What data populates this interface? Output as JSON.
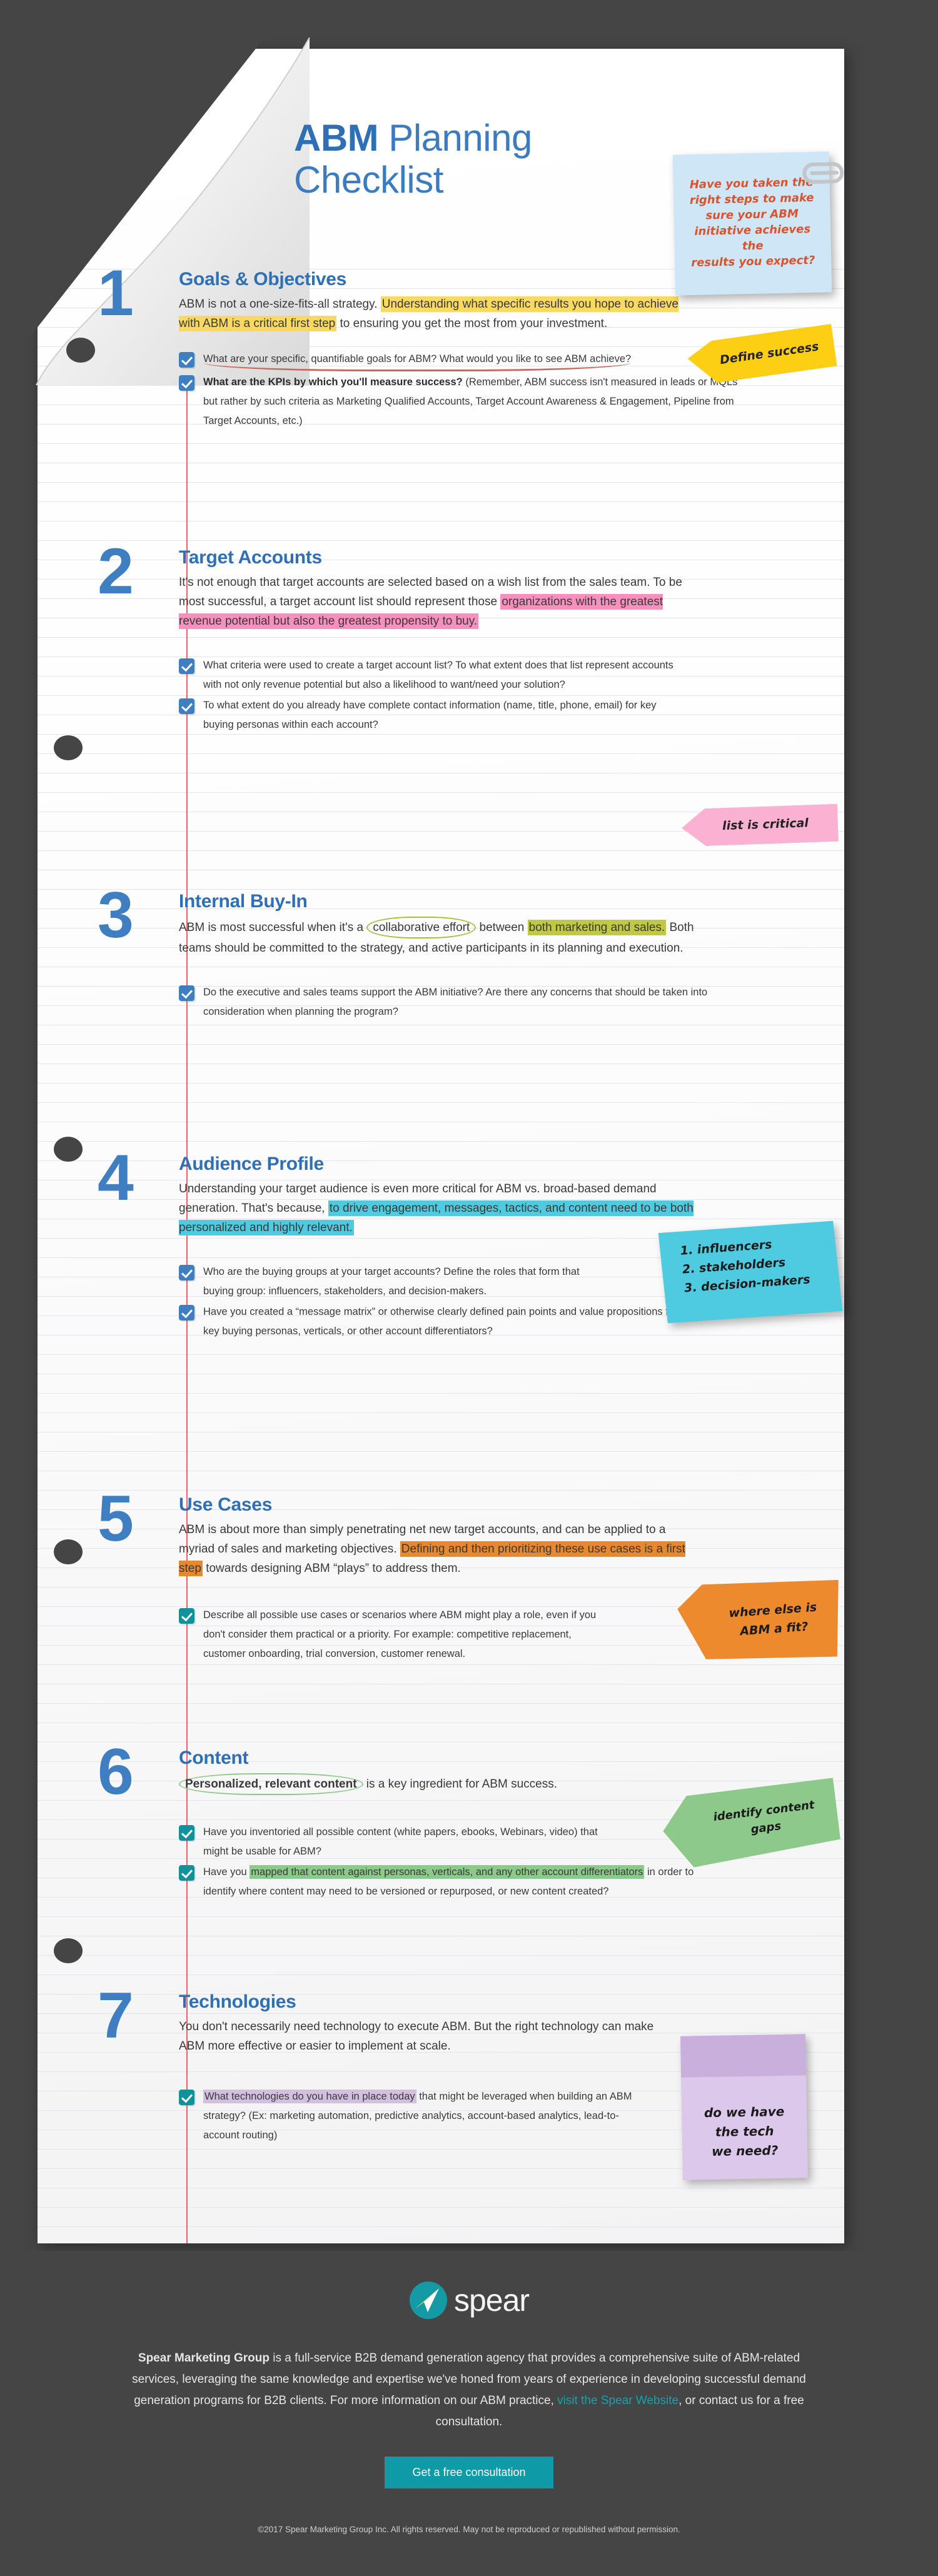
{
  "header": {
    "title_strong": "ABM",
    "title_rest": " Planning\nChecklist"
  },
  "colors": {
    "background": "#454545",
    "brand_blue": "#3f7fc1",
    "heading_blue": "#2f6fb5",
    "teal": "#0e9aa7",
    "margin_red": "#e8646b",
    "hl_yellow": "#f9d95f",
    "hl_pink": "#f88fbc",
    "hl_olive": "#c0c944",
    "hl_cyan": "#4ecbe0",
    "hl_orange": "#e8882c",
    "hl_green": "#8dc98a",
    "hl_purple": "#d3bfe0"
  },
  "sections": [
    {
      "number": "1",
      "title": "Goals & Objectives",
      "body_pre": "ABM is not a one-size-fits-all strategy.  ",
      "body_hl": "Understanding what specific results you hope to achieve with ABM is a critical first step",
      "body_post": " to ensuring you get the most from your investment.",
      "checks": [
        {
          "text": "What are your specific, quantifiable goals for ABM?  What would you like to see ABM achieve?",
          "bold": ""
        },
        {
          "bold": "What are the KPIs by which you'll measure success?",
          "text": " (Remember, ABM success isn't measured in leads or MQLs but rather by such criteria as Marketing Qualified Accounts, Target Account Awareness & Engagement, Pipeline from Target Accounts, etc.)"
        }
      ]
    },
    {
      "number": "2",
      "title": "Target Accounts",
      "body_pre": "It's not enough that target accounts are selected based on a wish list from the sales team.  To be most successful, a target account list should represent those ",
      "body_hl": "organizations with the greatest revenue potential but also the greatest propensity to buy.",
      "body_post": "",
      "checks": [
        {
          "text": "What criteria were used to create a target account list?  To what extent does that list represent accounts with not only revenue potential but also a likelihood to want/need your solution?",
          "bold": ""
        },
        {
          "text": "To what extent do you already have complete contact information (name, title, phone, email) for key buying personas within each account?",
          "bold": ""
        }
      ]
    },
    {
      "number": "3",
      "title": "Internal Buy-In",
      "body_pre": "ABM is most successful when it's a ",
      "body_circle": "collaborative effort",
      "body_mid": " between ",
      "body_hl": "both marketing and sales.",
      "body_post": " Both teams should be committed to the strategy, and active participants in its planning and execution.",
      "checks": [
        {
          "text": "Do the executive and sales teams support the ABM initiative?  Are there any concerns that should be taken into consideration when planning the program?",
          "bold": ""
        }
      ]
    },
    {
      "number": "4",
      "title": "Audience Profile",
      "body_pre": "Understanding your target audience is even more critical for ABM vs. broad-based demand generation.  That's because, ",
      "body_hl": "to drive engagement, messages, tactics, and content need to be both personalized and highly relevant.",
      "body_post": "",
      "checks": [
        {
          "text": "Who are the buying groups at your target accounts? Define the roles that form that buying group: influencers, stakeholders, and decision-makers.",
          "bold": ""
        },
        {
          "text": "Have you created a “message matrix” or otherwise clearly defined pain points and value propositions for each of the key buying personas, verticals, or other account differentiators?",
          "bold": ""
        }
      ]
    },
    {
      "number": "5",
      "title": "Use Cases",
      "body_pre": "ABM is about more than simply penetrating net new target accounts, and can be applied to a myriad of sales and marketing objectives.  ",
      "body_hl": "Defining and then prioritizing these use cases is a first step",
      "body_post": " towards designing ABM “plays” to address them.",
      "checks": [
        {
          "text": "Describe all possible use cases or scenarios where ABM might play a role,  even if you don't consider them practical or a priority.  For example:  competitive replacement, customer onboarding, trial conversion, customer renewal.",
          "bold": ""
        }
      ]
    },
    {
      "number": "6",
      "title": "Content",
      "body_circle": "Personalized, relevant content",
      "body_post": " is a key ingredient for ABM success.",
      "checks": [
        {
          "text": "Have you inventoried all possible content (white papers, ebooks, Webinars, video) that might be usable for ABM?",
          "bold": ""
        },
        {
          "pre": "Have you ",
          "hl": "mapped that content against personas, verticals, and any other account differentiators",
          "post": " in order to identify where content may need to be versioned or repurposed, or new content created?"
        }
      ]
    },
    {
      "number": "7",
      "title": "Technologies",
      "body_pre": "You don't necessarily need technology to execute ABM.  But the right technology can make ABM more effective or easier to implement at scale.",
      "body_hl": "",
      "body_post": "",
      "checks": [
        {
          "hl": "What technologies do you have in place today",
          "post": " that might be leveraged when building an ABM strategy?  (Ex: marketing automation, predictive analytics, account-based analytics, lead-to-account routing)"
        }
      ]
    }
  ],
  "notes": [
    {
      "id": "note-blue",
      "text": "Have you taken the\nright steps to make\nsure your ABM\ninitiative achieves the\nresults you expect?"
    },
    {
      "id": "note-yellow",
      "text": "Define  success"
    },
    {
      "id": "note-pink",
      "text": "list is critical"
    },
    {
      "id": "note-cyan",
      "text": "1. influencers\n2. stakeholders\n3. decision-makers"
    },
    {
      "id": "note-orange",
      "text": "where else is\nABM a fit?"
    },
    {
      "id": "note-green",
      "text": "identify content\ngaps"
    },
    {
      "id": "note-purple",
      "text": "do we have\nthe tech\nwe need?"
    }
  ],
  "footer": {
    "logo_word": "spear",
    "copy_bold": "Spear Marketing Group",
    "copy_1": " is a full-service B2B demand generation agency that provides a comprehensive suite of ABM-related services, leveraging the same knowledge and expertise we've honed from years of experience in developing successful demand generation programs for B2B clients.  For more information on our ABM practice, ",
    "link": "visit the Spear Website",
    "copy_2": ", or contact us for a free consultation.",
    "cta": "Get a free consultation",
    "legal": "©2017 Spear Marketing Group Inc.  All rights reserved.  May not be reproduced or republished without permission."
  }
}
